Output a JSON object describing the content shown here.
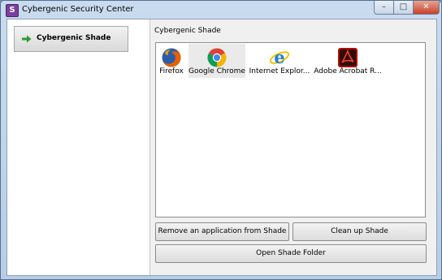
{
  "window": {
    "title": "Cybergenic Security Center",
    "app_icon_letter": "S",
    "controls": {
      "minimize": "–",
      "maximize": "□",
      "close": "✕"
    }
  },
  "nav": {
    "items": [
      {
        "label": "Cybergenic Shade",
        "icon": "arrow-right-icon",
        "selected": true
      }
    ]
  },
  "main": {
    "section_label": "Cybergenic Shade",
    "apps": [
      {
        "name": "Firefox",
        "icon": "firefox-icon",
        "selected": false
      },
      {
        "name": "Google Chrome",
        "icon": "chrome-icon",
        "selected": true
      },
      {
        "name": "Internet Explor...",
        "icon": "internet-explorer-icon",
        "selected": false
      },
      {
        "name": "Adobe Acrobat R...",
        "icon": "adobe-acrobat-icon",
        "selected": false
      }
    ],
    "buttons": {
      "remove": "Remove an application from Shade",
      "cleanup": "Clean up Shade",
      "open_folder": "Open Shade Folder"
    }
  },
  "colors": {
    "title_bar": "#c9dcef",
    "close_button": "#c8412a",
    "nav_arrow": "#2f9a2f",
    "selected_app": "#eaeaea"
  }
}
